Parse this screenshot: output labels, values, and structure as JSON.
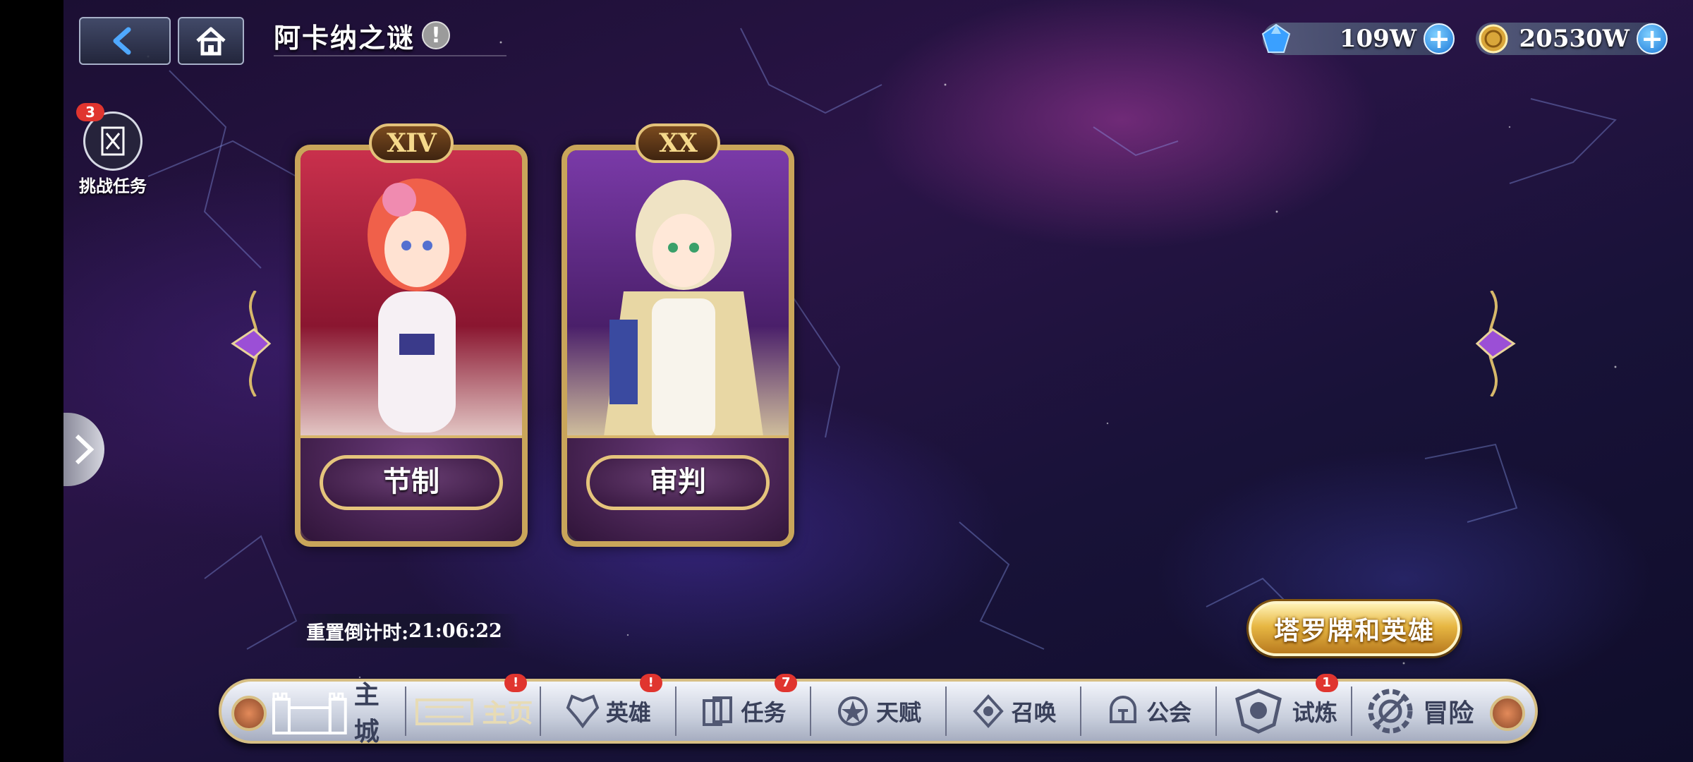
{
  "header": {
    "back_icon": "back-arrow-icon",
    "home_icon": "home-icon",
    "title": "阿卡纳之谜",
    "info_glyph": "!"
  },
  "resources": {
    "gems": {
      "icon": "blue-gem-icon",
      "value": "109W",
      "plus": "+"
    },
    "gold": {
      "icon": "gold-coin-icon",
      "value": "20530W",
      "plus": "+"
    }
  },
  "quest": {
    "badge": "3",
    "label": "挑战任务",
    "icon": "scroll-sword-icon"
  },
  "cards": [
    {
      "numeral": "XIV",
      "name": "节制",
      "theme_color": "#b3263c"
    },
    {
      "numeral": "XX",
      "name": "审判",
      "theme_color": "#6a2f8a"
    }
  ],
  "countdown": {
    "label": "重置倒计时:",
    "time": "21:06:22"
  },
  "tarot_button": {
    "label": "塔罗牌和英雄"
  },
  "nav": [
    {
      "label": "主城",
      "icon": "castle-icon",
      "badge": ""
    },
    {
      "label": "主页",
      "icon": "banner-icon",
      "badge": "!"
    },
    {
      "label": "英雄",
      "icon": "hero-wings-icon",
      "badge": "!"
    },
    {
      "label": "任务",
      "icon": "quest-cards-icon",
      "badge": "7"
    },
    {
      "label": "天赋",
      "icon": "talent-star-icon",
      "badge": ""
    },
    {
      "label": "召唤",
      "icon": "summon-crystal-icon",
      "badge": ""
    },
    {
      "label": "公会",
      "icon": "guild-helmet-icon",
      "badge": ""
    },
    {
      "label": "试炼",
      "icon": "trial-crest-icon",
      "badge": "1"
    },
    {
      "label": "冒险",
      "icon": "adventure-gear-icon",
      "badge": ""
    }
  ],
  "colors": {
    "gold_trim": "#d7bf84",
    "badge_red": "#e0352f",
    "plus_blue": "#1c78d8"
  }
}
